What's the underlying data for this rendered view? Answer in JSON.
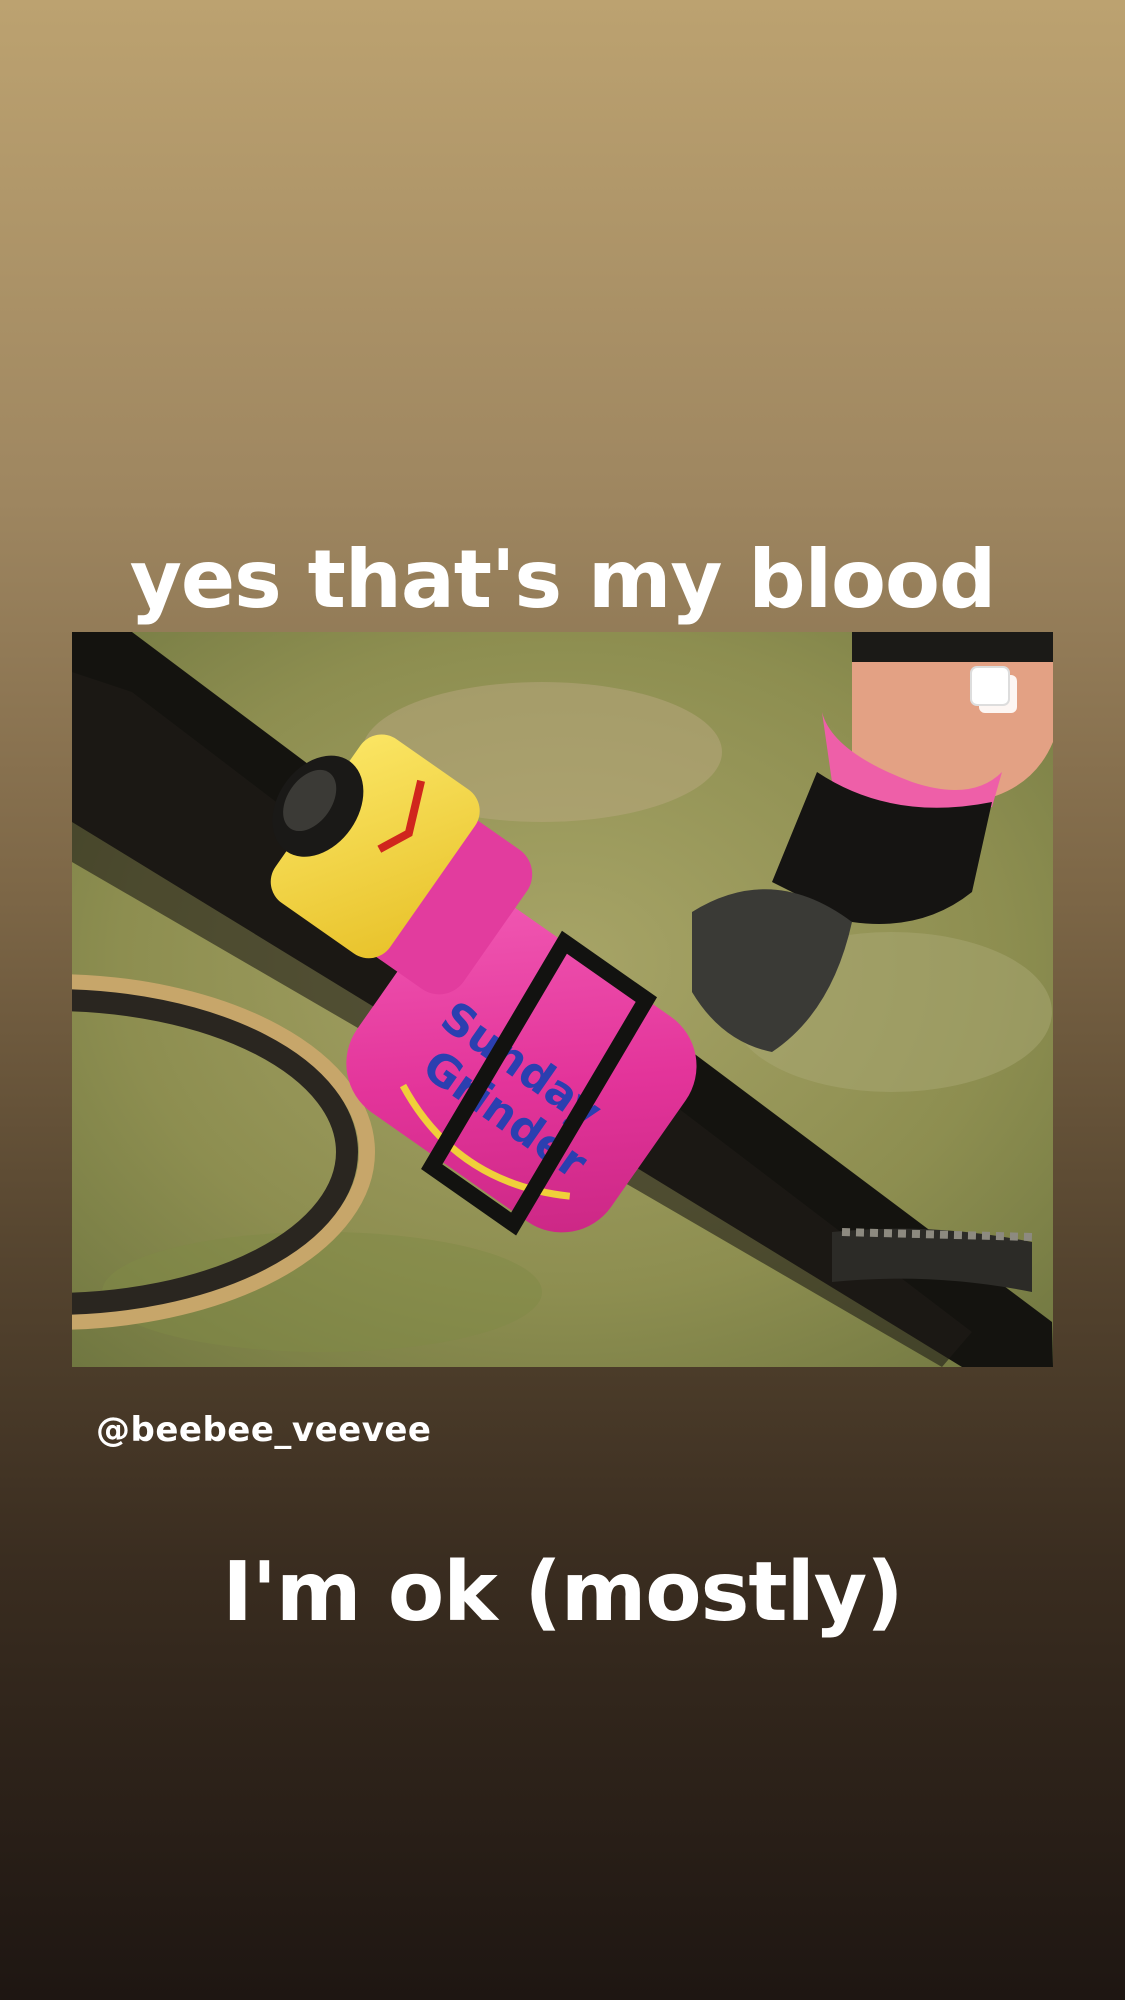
{
  "story": {
    "caption_top": "yes that's my blood",
    "caption_bottom": "I'm ok (mostly)",
    "mention": "@beebee_veevee"
  },
  "post": {
    "image_subject": "pink water bottle with yellow cap in a bike bottle cage",
    "overlay_icon": "multiple-photos-icon"
  },
  "colors": {
    "bg_top": "#bca270",
    "bg_bottom": "#1e1612",
    "text": "#ffffff",
    "bottle_pink": "#e83a9e",
    "cap_yellow": "#f4d63a"
  }
}
